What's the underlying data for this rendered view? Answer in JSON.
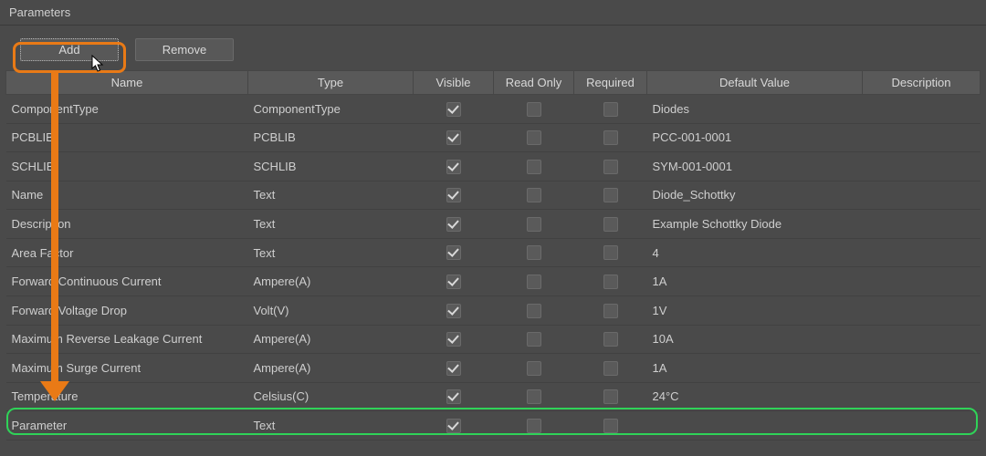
{
  "panel": {
    "title": "Parameters"
  },
  "toolbar": {
    "add_label": "Add",
    "remove_label": "Remove"
  },
  "columns": {
    "name": "Name",
    "type": "Type",
    "visible": "Visible",
    "readonly": "Read Only",
    "required": "Required",
    "default": "Default Value",
    "description": "Description"
  },
  "rows": [
    {
      "name": "ComponentType",
      "type": "ComponentType",
      "visible": true,
      "readonly": false,
      "required": false,
      "default": "Diodes",
      "description": ""
    },
    {
      "name": "PCBLIB",
      "type": "PCBLIB",
      "visible": true,
      "readonly": false,
      "required": false,
      "default": "PCC-001-0001",
      "description": ""
    },
    {
      "name": "SCHLIB",
      "type": "SCHLIB",
      "visible": true,
      "readonly": false,
      "required": false,
      "default": "SYM-001-0001",
      "description": ""
    },
    {
      "name": "Name",
      "type": "Text",
      "visible": true,
      "readonly": false,
      "required": false,
      "default": "Diode_Schottky",
      "description": ""
    },
    {
      "name": "Description",
      "type": "Text",
      "visible": true,
      "readonly": false,
      "required": false,
      "default": "Example Schottky Diode",
      "description": ""
    },
    {
      "name": "Area Factor",
      "type": "Text",
      "visible": true,
      "readonly": false,
      "required": false,
      "default": "4",
      "description": ""
    },
    {
      "name": "Forward Continuous Current",
      "type": "Ampere(A)",
      "visible": true,
      "readonly": false,
      "required": false,
      "default": "1A",
      "description": ""
    },
    {
      "name": "Forward Voltage Drop",
      "type": "Volt(V)",
      "visible": true,
      "readonly": false,
      "required": false,
      "default": "1V",
      "description": ""
    },
    {
      "name": "Maximum Reverse Leakage Current",
      "type": "Ampere(A)",
      "visible": true,
      "readonly": false,
      "required": false,
      "default": "10A",
      "description": ""
    },
    {
      "name": "Maximum Surge Current",
      "type": "Ampere(A)",
      "visible": true,
      "readonly": false,
      "required": false,
      "default": "1A",
      "description": ""
    },
    {
      "name": "Temperature",
      "type": "Celsius(C)",
      "visible": true,
      "readonly": false,
      "required": false,
      "default": "24°C",
      "description": ""
    },
    {
      "name": "Parameter",
      "type": "Text",
      "visible": true,
      "readonly": false,
      "required": false,
      "default": "",
      "description": ""
    }
  ],
  "annotations": {
    "add_highlight_color": "#e97a16",
    "new_row_highlight_color": "#2fd358"
  }
}
